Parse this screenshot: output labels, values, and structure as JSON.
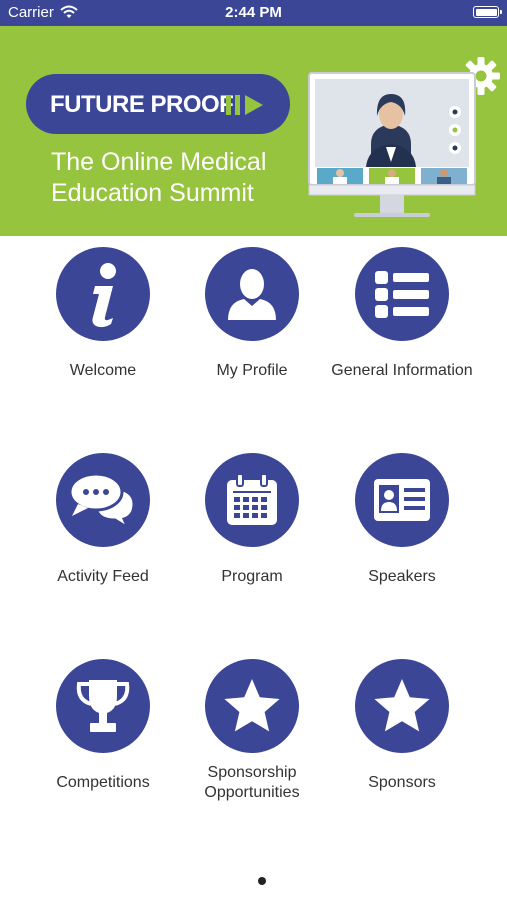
{
  "status_bar": {
    "carrier": "Carrier",
    "time": "2:44 PM"
  },
  "banner": {
    "brand": "FUTURE PROOF",
    "tagline_line1": "The Online Medical",
    "tagline_line2": "Education Summit"
  },
  "tiles": [
    {
      "label": "Welcome",
      "icon": "info-icon"
    },
    {
      "label": "My Profile",
      "icon": "person-icon"
    },
    {
      "label": "General Information",
      "icon": "list-icon"
    },
    {
      "label": "Activity Feed",
      "icon": "chat-bubbles-icon"
    },
    {
      "label": "Program",
      "icon": "calendar-icon"
    },
    {
      "label": "Speakers",
      "icon": "id-card-icon"
    },
    {
      "label": "Competitions",
      "icon": "trophy-icon"
    },
    {
      "label": "Sponsorship Opportunities",
      "icon": "star-icon"
    },
    {
      "label": "Sponsors",
      "icon": "star-icon"
    }
  ],
  "colors": {
    "primary": "#3B4696",
    "banner_green": "#97C43E"
  },
  "page_indicator": {
    "current": 1,
    "total": 1
  }
}
